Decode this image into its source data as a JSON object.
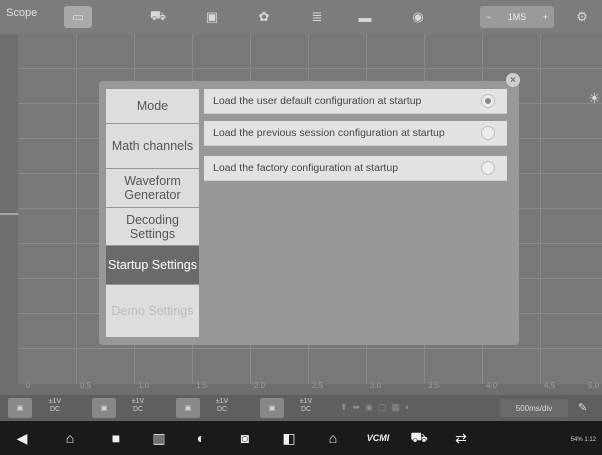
{
  "app": {
    "title": "Scope"
  },
  "toolbar": {
    "icons": [
      "panel-icon",
      "car-icon",
      "save-icon",
      "gear-icon",
      "list-icon",
      "folder-icon",
      "help-icon",
      "settings-icon"
    ],
    "timebase_minus": "−",
    "timebase_value": "1MS",
    "timebase_plus": "+"
  },
  "axis": {
    "x_ticks": [
      "0",
      "0.5",
      "1.0",
      "1.5",
      "2.0",
      "2.5",
      "3.0",
      "3.5",
      "4.0",
      "4.5",
      "5.0"
    ]
  },
  "dialog": {
    "menu": [
      {
        "label": "Mode",
        "state": "normal"
      },
      {
        "label": "Math channels",
        "state": "normal"
      },
      {
        "label": "Waveform Generator",
        "state": "normal"
      },
      {
        "label": "Decoding Settings",
        "state": "normal"
      },
      {
        "label": "Startup Settings",
        "state": "selected"
      },
      {
        "label": "Demo Settings",
        "state": "disabled"
      }
    ],
    "options": [
      {
        "label": "Load the user default configuration at startup",
        "checked": true
      },
      {
        "label": "Load the previous session configuration at startup",
        "checked": false
      },
      {
        "label": "Load the factory configuration at startup",
        "checked": false
      }
    ]
  },
  "channels": [
    {
      "range": "±1V",
      "coupling": "DC"
    },
    {
      "range": "±1V",
      "coupling": "DC"
    },
    {
      "range": "±1V",
      "coupling": "DC"
    },
    {
      "range": "±1V",
      "coupling": "DC"
    }
  ],
  "timebase_div": "500ms/div",
  "navbar": {
    "icons": [
      "back-icon",
      "home-icon",
      "recent-apps-icon",
      "split-icon",
      "browser-icon",
      "camera-icon",
      "screen-record-icon",
      "house-icon",
      "vcmi-icon",
      "car-icon",
      "network-icon"
    ],
    "vcmi_label": "VCMI"
  },
  "status": {
    "text": "54% 1:12"
  }
}
